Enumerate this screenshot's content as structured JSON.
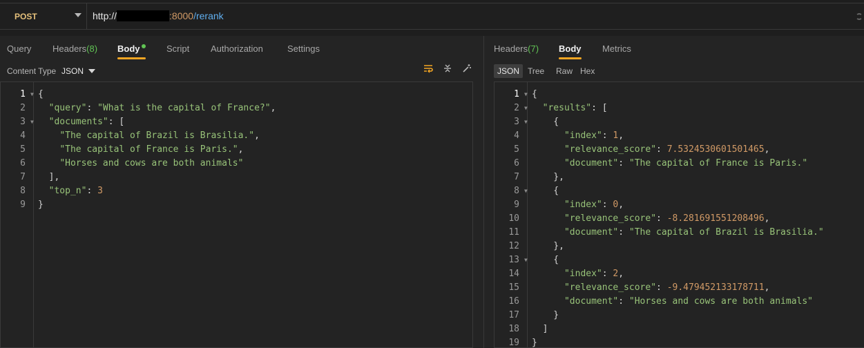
{
  "request": {
    "method": "POST",
    "url_prefix": "http://",
    "url_port": ":8000",
    "url_path": "/rerank"
  },
  "left_tabs": {
    "query": "Query",
    "headers": "Headers",
    "headers_count": "(8)",
    "body": "Body",
    "script": "Script",
    "authorization": "Authorization",
    "settings": "Settings"
  },
  "content_type": {
    "label": "Content Type",
    "value": "JSON"
  },
  "right_tabs": {
    "headers": "Headers",
    "headers_count": "(7)",
    "body": "Body",
    "metrics": "Metrics"
  },
  "view_tabs": [
    "JSON",
    "Tree",
    "Raw",
    "Hex"
  ],
  "colors": {
    "accent": "#f5a623",
    "string": "#98c379",
    "number": "#d19a66",
    "count": "#61c454"
  },
  "request_body_lines": [
    "{",
    "  \"query\": \"What is the capital of France?\",",
    "  \"documents\": [",
    "    \"The capital of Brazil is Brasilia.\",",
    "    \"The capital of France is Paris.\",",
    "    \"Horses and cows are both animals\"",
    "  ],",
    "  \"top_n\": 3",
    "}"
  ],
  "response_body_lines": [
    "{",
    "  \"results\": [",
    "    {",
    "      \"index\": 1,",
    "      \"relevance_score\": 7.5324530601501465,",
    "      \"document\": \"The capital of France is Paris.\"",
    "    },",
    "    {",
    "      \"index\": 0,",
    "      \"relevance_score\": -8.281691551208496,",
    "      \"document\": \"The capital of Brazil is Brasilia.\"",
    "    },",
    "    {",
    "      \"index\": 2,",
    "      \"relevance_score\": -9.479452133178711,",
    "      \"document\": \"Horses and cows are both animals\"",
    "    }",
    "  ]",
    "}"
  ]
}
